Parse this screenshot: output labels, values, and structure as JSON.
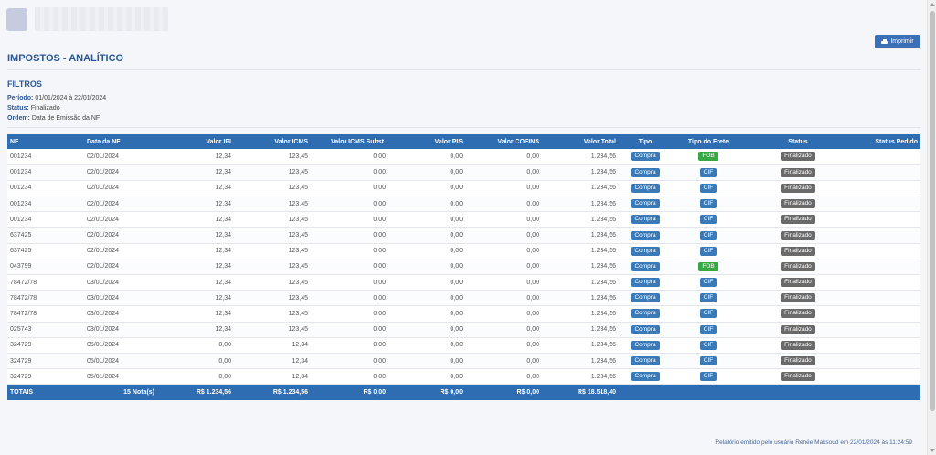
{
  "header": {
    "print_label": "Imprimir",
    "title": "IMPOSTOS - ANALÍTICO"
  },
  "filters": {
    "title": "FILTROS",
    "periodo_label": "Período:",
    "periodo_value": "01/01/2024 à 22/01/2024",
    "status_label": "Status:",
    "status_value": "Finalizado",
    "ordem_label": "Ordem:",
    "ordem_value": "Data de Emissão da NF"
  },
  "table": {
    "columns": [
      "NF",
      "Data da NF",
      "Valor IPI",
      "Valor ICMS",
      "Valor ICMS Subst.",
      "Valor PIS",
      "Valor COFINS",
      "Valor Total",
      "Tipo",
      "Tipo do Frete",
      "Status",
      "Status Pedido"
    ],
    "rows": [
      [
        "001234",
        "02/01/2024",
        "12,34",
        "123,45",
        "0,00",
        "0,00",
        "0,00",
        "1.234,56",
        "Compra",
        "FOB",
        "Finalizado",
        ""
      ],
      [
        "001234",
        "02/01/2024",
        "12,34",
        "123,45",
        "0,00",
        "0,00",
        "0,00",
        "1.234,56",
        "Compra",
        "CIF",
        "Finalizado",
        ""
      ],
      [
        "001234",
        "02/01/2024",
        "12,34",
        "123,45",
        "0,00",
        "0,00",
        "0,00",
        "1.234,56",
        "Compra",
        "CIF",
        "Finalizado",
        ""
      ],
      [
        "001234",
        "02/01/2024",
        "12,34",
        "123,45",
        "0,00",
        "0,00",
        "0,00",
        "1.234,56",
        "Compra",
        "CIF",
        "Finalizado",
        ""
      ],
      [
        "001234",
        "02/01/2024",
        "12,34",
        "123,45",
        "0,00",
        "0,00",
        "0,00",
        "1.234,56",
        "Compra",
        "CIF",
        "Finalizado",
        ""
      ],
      [
        "637425",
        "02/01/2024",
        "12,34",
        "123,45",
        "0,00",
        "0,00",
        "0,00",
        "1.234,56",
        "Compra",
        "CIF",
        "Finalizado",
        ""
      ],
      [
        "637425",
        "02/01/2024",
        "12,34",
        "123,45",
        "0,00",
        "0,00",
        "0,00",
        "1.234,56",
        "Compra",
        "CIF",
        "Finalizado",
        ""
      ],
      [
        "043799",
        "02/01/2024",
        "12,34",
        "123,45",
        "0,00",
        "0,00",
        "0,00",
        "1.234,56",
        "Compra",
        "FOB",
        "Finalizado",
        ""
      ],
      [
        "78472/78",
        "03/01/2024",
        "12,34",
        "123,45",
        "0,00",
        "0,00",
        "0,00",
        "1.234,56",
        "Compra",
        "CIF",
        "Finalizado",
        ""
      ],
      [
        "78472/78",
        "03/01/2024",
        "12,34",
        "123,45",
        "0,00",
        "0,00",
        "0,00",
        "1.234,56",
        "Compra",
        "CIF",
        "Finalizado",
        ""
      ],
      [
        "78472/78",
        "03/01/2024",
        "12,34",
        "123,45",
        "0,00",
        "0,00",
        "0,00",
        "1.234,56",
        "Compra",
        "CIF",
        "Finalizado",
        ""
      ],
      [
        "025743",
        "03/01/2024",
        "12,34",
        "123,45",
        "0,00",
        "0,00",
        "0,00",
        "1.234,56",
        "Compra",
        "CIF",
        "Finalizado",
        ""
      ],
      [
        "324729",
        "05/01/2024",
        "0,00",
        "12,34",
        "0,00",
        "0,00",
        "0,00",
        "1.234,56",
        "Compra",
        "CIF",
        "Finalizado",
        ""
      ],
      [
        "324729",
        "05/01/2024",
        "0,00",
        "12,34",
        "0,00",
        "0,00",
        "0,00",
        "1.234,56",
        "Compra",
        "CIF",
        "Finalizado",
        ""
      ],
      [
        "324729",
        "05/01/2024",
        "0,00",
        "12,34",
        "0,00",
        "0,00",
        "0,00",
        "1.234,56",
        "Compra",
        "CIF",
        "Finalizado",
        ""
      ]
    ],
    "totals": {
      "label": "TOTAIS",
      "count": "15 Nota(s)",
      "ipi": "R$ 1.234,56",
      "icms": "R$ 1.234,56",
      "icms_subst": "R$ 0,00",
      "pis": "R$ 0,00",
      "cofins": "R$ 0,00",
      "total": "R$ 18.518,40"
    }
  },
  "footer": {
    "note": "Relatório emitido pelo usuário Renée Maksoud em 22/01/2024 às 11:24:59"
  },
  "colors": {
    "header_blue": "#2f6db3",
    "title_blue": "#2b5797",
    "badge_blue": "#3a7ab8",
    "badge_green": "#38a845",
    "badge_gray": "#6a6a6a"
  },
  "icons": {
    "print": "printer-icon"
  }
}
